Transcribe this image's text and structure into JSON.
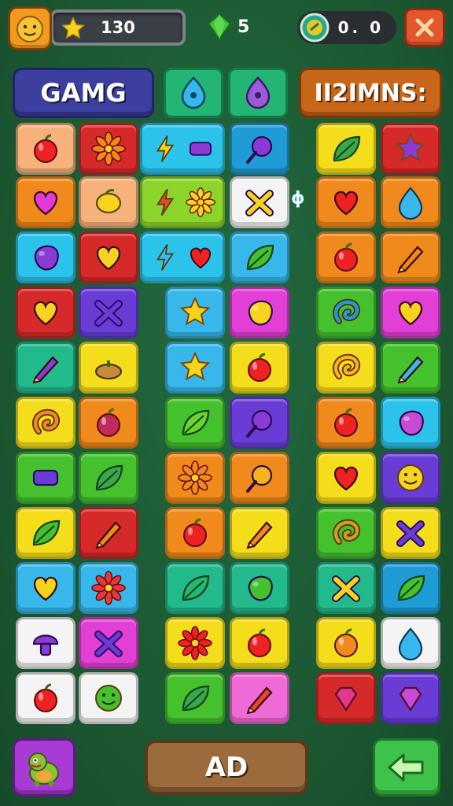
{
  "hud": {
    "score": "130",
    "gems": "5",
    "coins": "0. 0",
    "avatar_icon": "smiley-face-icon",
    "star_icon": "star-icon",
    "gem_icon": "green-gem-icon",
    "coin_icon": "coin-icon",
    "close_icon": "close-icon"
  },
  "headers": {
    "left_title": "GAMG",
    "right_title": "II2IMNS:"
  },
  "board": {
    "colors": {
      "peach": "#f6b27a",
      "red": "#d62a2a",
      "cyan": "#2bc3ea",
      "blue": "#1f9bd6",
      "yellow": "#f4dd1a",
      "orange": "#f08a1c",
      "green": "#45c12e",
      "white": "#f4f4f4",
      "purple": "#6a3cd6",
      "magenta": "#e23fd6",
      "teal": "#22b98c",
      "pink": "#ef6ad6",
      "lime": "#8cd42a",
      "ltblue": "#37b7ea"
    }
  },
  "middle_glyph": "ϕ",
  "bottom": {
    "ad_label": "AD",
    "pet_icon": "dino-pet-icon",
    "back_icon": "back-arrow-icon"
  }
}
